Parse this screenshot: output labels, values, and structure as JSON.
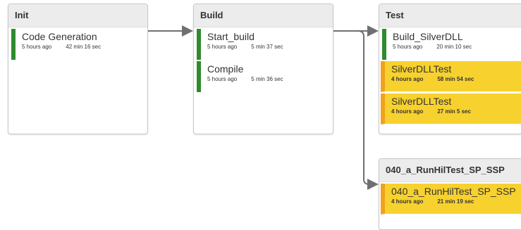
{
  "stages": {
    "init": {
      "title": "Init",
      "jobs": [
        {
          "name": "Code Generation",
          "time": "5 hours ago",
          "duration": "42 min 16 sec",
          "status": "success"
        }
      ]
    },
    "build": {
      "title": "Build",
      "jobs": [
        {
          "name": "Start_build",
          "time": "5 hours ago",
          "duration": "5 min 37 sec",
          "status": "success"
        },
        {
          "name": "Compile",
          "time": "5 hours ago",
          "duration": "5 min 36 sec",
          "status": "success"
        }
      ]
    },
    "test": {
      "title": "Test",
      "jobs": [
        {
          "name": "Build_SilverDLL",
          "time": "5 hours ago",
          "duration": "20 min 10 sec",
          "status": "success"
        },
        {
          "name": "SilverDLLTest",
          "time": "4 hours ago",
          "duration": "58 min 54 sec",
          "status": "unstable"
        },
        {
          "name": "SilverDLLTest",
          "time": "4 hours ago",
          "duration": "27 min 5 sec",
          "status": "unstable"
        }
      ]
    },
    "hil": {
      "title": "040_a_RunHilTest_SP_SSP",
      "jobs": [
        {
          "name": "040_a_RunHilTest_SP_SSP",
          "time": "4 hours ago",
          "duration": "21 min 19 sec",
          "status": "unstable"
        }
      ]
    }
  },
  "colors": {
    "success": "#2e8b2e",
    "unstable_bg": "#f7d12e",
    "unstable_bar": "#f0a21d",
    "connector": "#707070"
  }
}
